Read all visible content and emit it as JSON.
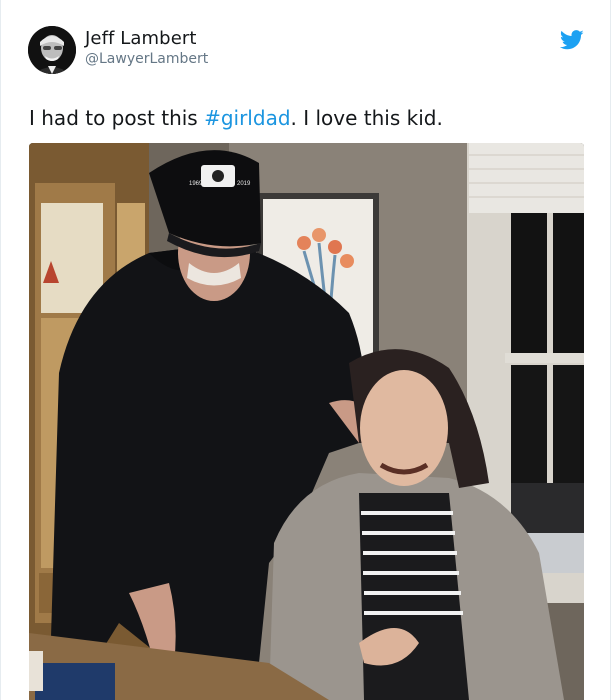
{
  "tweet": {
    "display_name": "Jeff Lambert",
    "handle": "@LawyerLambert",
    "text_before": "I had to post this ",
    "hashtag": "#girldad",
    "text_after": ". I love this kid.",
    "avatar_icon": "user-avatar-portrait",
    "brand_icon": "twitter-bird-icon",
    "brand_color": "#1da1f2",
    "hashtag_color": "#1b95e0"
  },
  "photo": {
    "description_icon": "tweet-photo",
    "cap_logo_text_left": "1969",
    "cap_logo_text_right": "2019"
  }
}
